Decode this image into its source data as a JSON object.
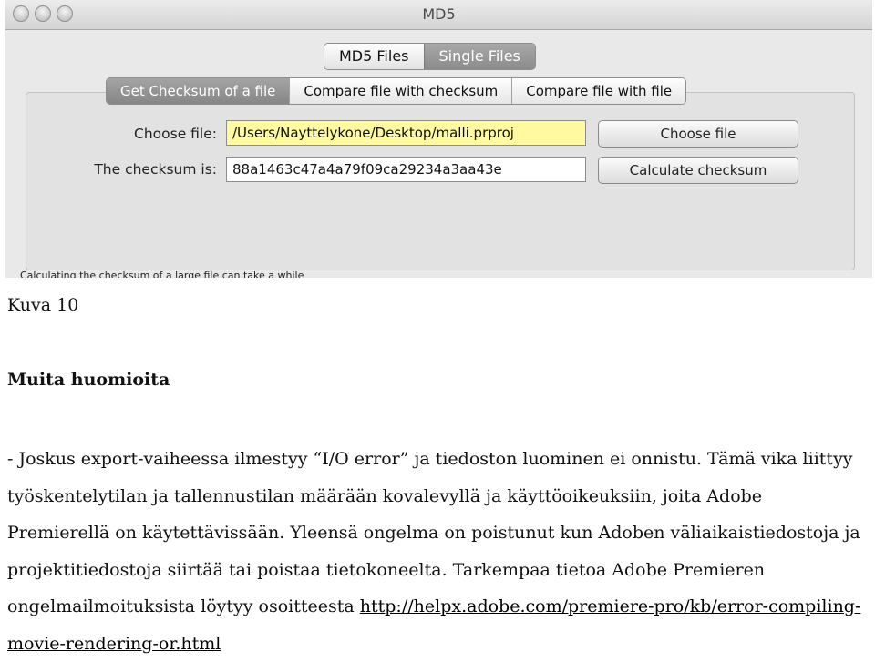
{
  "window": {
    "title": "MD5",
    "top_tabs": [
      "MD5 Files",
      "Single Files"
    ],
    "inner_tabs": [
      "Get Checksum of a file",
      "Compare file with checksum",
      "Compare file with file"
    ],
    "choose_file_label": "Choose file:",
    "file_path": "/Users/Nayttelykone/Desktop/malli.prproj",
    "checksum_label": "The checksum is:",
    "checksum_value": "88a1463c47a4a79f09ca29234a3aa43e",
    "choose_file_button": "Choose file",
    "calculate_button": "Calculate checksum",
    "status_text": "Calculating the checksum of a large file can take a while"
  },
  "document": {
    "caption": "Kuva 10",
    "heading": "Muita huomioita",
    "paragraph_text": "- Joskus export-vaiheessa ilmestyy “I/O error” ja tiedoston luominen ei onnistu. Tämä vika liittyy työskentelytilan ja tallennustilan määrään kovalevyllä ja käyttöoikeuksiin, joita Adobe Premierellä on käytettävissään. Yleensä ongelma on poistunut kun Adoben väliaikaistiedostoja ja projektitiedostoja siirtää tai poistaa tietokoneelta. Tarkempaa tietoa Adobe Premieren ongelmailmoituksista löytyy osoitteesta ",
    "link_text": "http://helpx.adobe.com/premiere-pro/kb/error-compiling-movie-rendering-or.html"
  }
}
